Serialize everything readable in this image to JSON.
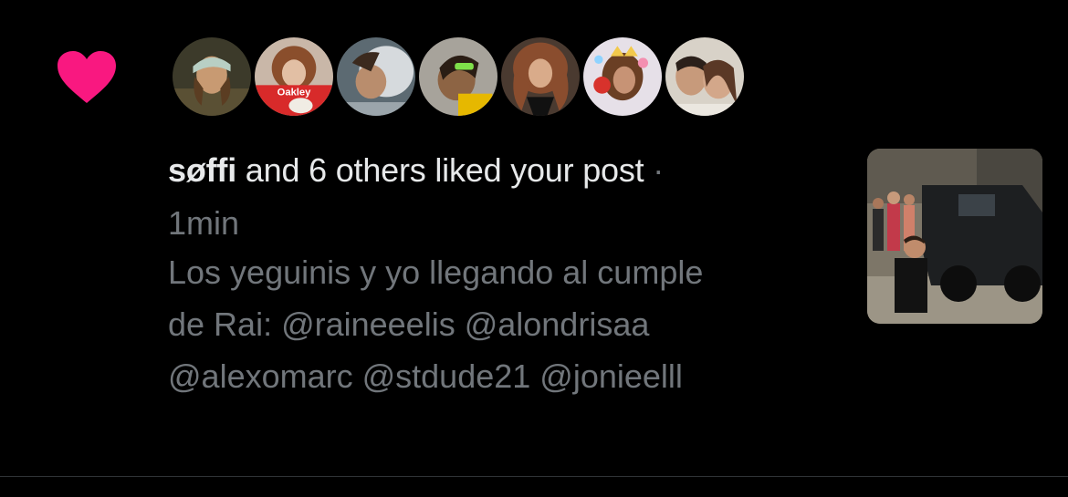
{
  "notification": {
    "type_icon": "heart-icon",
    "accent_color": "#f91880",
    "actor": "søffi",
    "action_text": " and 6 others liked your post",
    "separator": " ·",
    "time": "1min",
    "post_text": "Los yeguinis y yo llegando al cumple de Rai: @raineeelis @alondrisaa @alexomarc @stdude21 @jonieelll",
    "liker_avatar_count": 7,
    "avatar_caption_1": "Oakley",
    "has_media_thumbnail": true
  },
  "colors": {
    "background": "#000000",
    "primary_text": "#e7e9ea",
    "secondary_text": "#71767b",
    "divider": "#2f3336"
  }
}
